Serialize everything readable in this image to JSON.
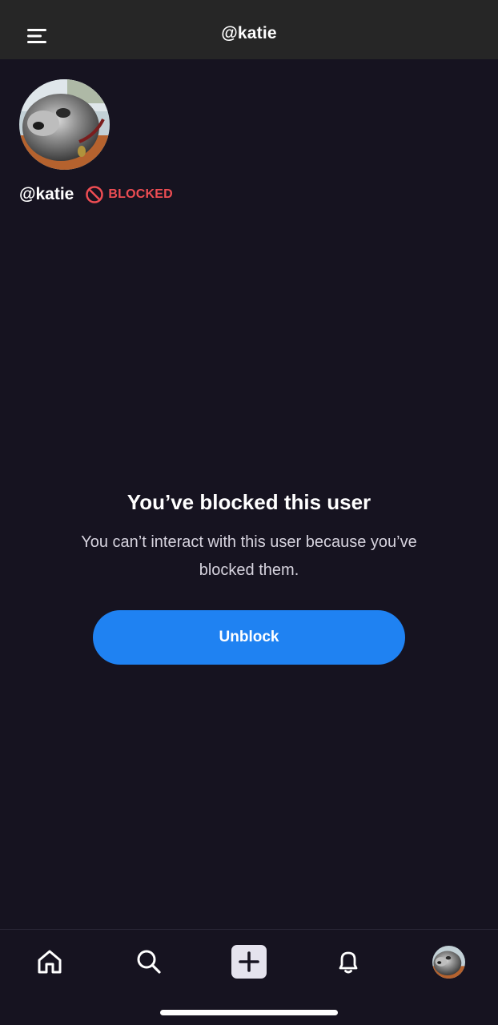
{
  "header": {
    "title": "@katie",
    "menu_icon": "menu-icon"
  },
  "profile": {
    "handle": "@katie",
    "badge_label": "BLOCKED",
    "badge_icon": "blocked-icon",
    "badge_color": "#ee4d53"
  },
  "message": {
    "title": "You’ve blocked this user",
    "body": "You can’t interact with this user because you’ve blocked them."
  },
  "actions": {
    "unblock_label": "Unblock",
    "unblock_color": "#1f82f2"
  },
  "bottom_nav": {
    "items": [
      "home-icon",
      "search-icon",
      "plus-icon",
      "bell-icon",
      "avatar"
    ]
  },
  "colors": {
    "background": "#161320",
    "header": "#262626"
  }
}
